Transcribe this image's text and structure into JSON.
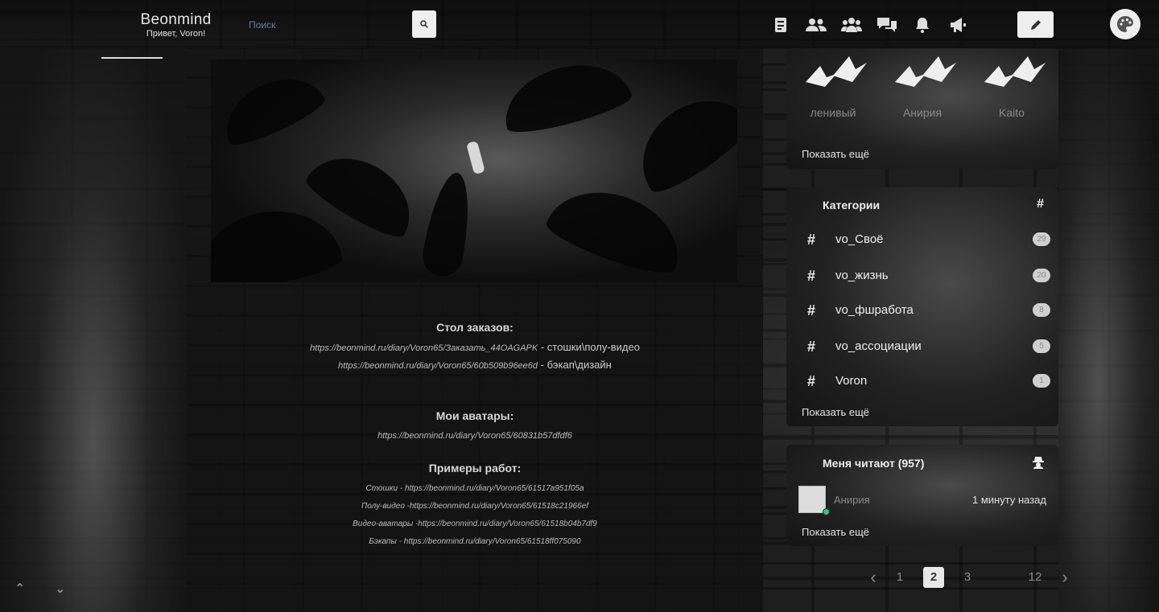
{
  "header": {
    "brand_title": "Beonmind",
    "brand_subtitle": "Привет, Voron!",
    "search_link": "Поиск",
    "nav_icons": [
      "diary-icon",
      "friends-icon",
      "communities-icon",
      "messages-icon",
      "notifications-icon",
      "announcements-icon"
    ],
    "edit_icon": "pencil-icon",
    "theme_icon": "palette-icon"
  },
  "post": {
    "orders_title": "Стол заказов:",
    "orders": [
      {
        "url": "https://beonmind.ru/diary/Voron65/Заказать_44OAGAPK",
        "desc": " - стошки\\полу-видео"
      },
      {
        "url": "https://beonmind.ru/diary/Voron65/60b509b96ee6d",
        "desc": " - бэкап\\дизайн"
      }
    ],
    "avatars_title": "Мои аватары:",
    "avatars_link": "https://beonmind.ru/diary/Voron65/60831b57dfdf6",
    "examples_title": "Примеры работ:",
    "examples": [
      "Стошки - https://beonmind.ru/diary/Voron65/61517a951f05a",
      "Полу-видео -https://beonmind.ru/diary/Voron65/61518c21966ef",
      "Видео-аватары -https://beonmind.ru/diary/Voron65/61518b04b7df9",
      "Бэкапы - https://beonmind.ru/diary/Voron65/61518ff075090"
    ]
  },
  "friends": {
    "items": [
      {
        "name": "ленивый"
      },
      {
        "name": "Анирия"
      },
      {
        "name": "Kaito"
      }
    ],
    "show_more": "Показать ещё"
  },
  "categories": {
    "title": "Категории",
    "header_icon": "#",
    "items": [
      {
        "name": "vo_Своё",
        "count": "29"
      },
      {
        "name": "vo_жизнь",
        "count": "20"
      },
      {
        "name": "vo_фшработа",
        "count": "8"
      },
      {
        "name": "vo_ассоциации",
        "count": "5"
      },
      {
        "name": "Voron",
        "count": "1"
      }
    ],
    "show_more": "Показать ещё"
  },
  "readers": {
    "title": "Меня читают (957)",
    "items": [
      {
        "name": "Анирия",
        "time": "1 минуту назад"
      }
    ],
    "show_more": "Показать ещё"
  },
  "pagination": {
    "prev": "‹",
    "pages": [
      "1",
      "2",
      "3",
      "12"
    ],
    "current": "2",
    "next": "›"
  },
  "scroll": {
    "up": "⌃",
    "down": "⌄"
  }
}
